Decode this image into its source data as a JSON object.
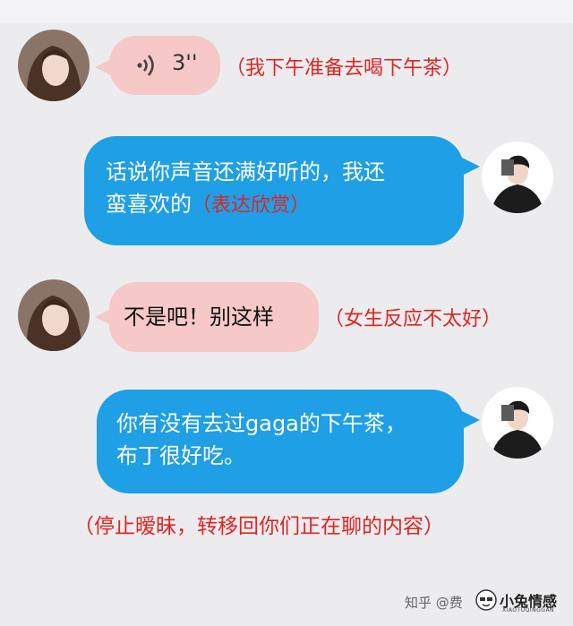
{
  "messages": [
    {
      "voice_duration": "3''",
      "annotation": "（我下午准备去喝下午茶）"
    },
    {
      "line1": "话说你声音还满好听的，我还",
      "line2": "蛮喜欢的",
      "inline_note": "（表达欣赏）"
    },
    {
      "text": "不是吧！别这样",
      "annotation": "（女生反应不太好）"
    },
    {
      "line1": "你有没有去过gaga的下午茶，",
      "line2": "布丁很好吃。"
    }
  ],
  "bottom_annotation": "（停止暧昧，转移回你们正在聊的内容）",
  "watermark": {
    "source": "知乎 @费",
    "brand": "小兔情感",
    "brand_pinyin": "XIAOTUQINGGAN"
  },
  "colors": {
    "blue_bubble": "#1e9fe6",
    "pink_bubble": "#f6c8c8",
    "annotation": "#e02424"
  }
}
